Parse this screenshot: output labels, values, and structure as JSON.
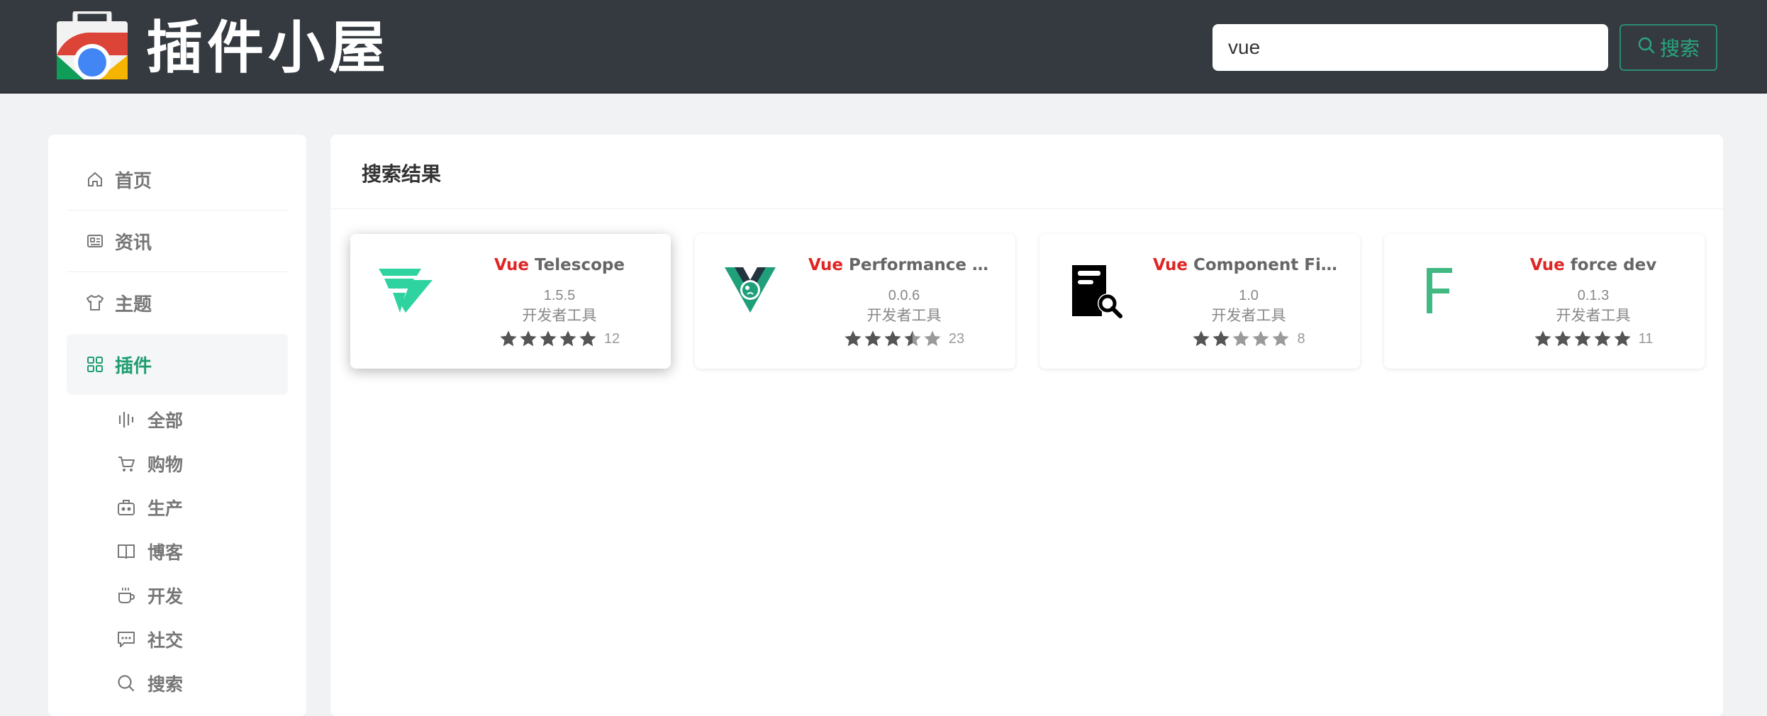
{
  "header": {
    "logo_text": "插件小屋",
    "search_value": "vue",
    "search_button_label": "搜索"
  },
  "sidebar": {
    "items": [
      {
        "label": "首页",
        "icon": "home-icon",
        "active": false
      },
      {
        "label": "资讯",
        "icon": "news-icon",
        "active": false
      },
      {
        "label": "主题",
        "icon": "shirt-icon",
        "active": false
      },
      {
        "label": "插件",
        "icon": "grid-icon",
        "active": true
      }
    ],
    "sub_items": [
      {
        "label": "全部",
        "icon": "bars-icon"
      },
      {
        "label": "购物",
        "icon": "cart-icon"
      },
      {
        "label": "生产",
        "icon": "briefcase-icon"
      },
      {
        "label": "博客",
        "icon": "book-icon"
      },
      {
        "label": "开发",
        "icon": "coffee-icon"
      },
      {
        "label": "社交",
        "icon": "chat-icon"
      },
      {
        "label": "搜索",
        "icon": "search-icon"
      }
    ]
  },
  "main": {
    "title": "搜索结果",
    "results": [
      {
        "keyword": "Vue",
        "name": "Telescope",
        "version": "1.5.5",
        "category": "开发者工具",
        "rating": 5,
        "count": "12",
        "icon": "vue-telescope-logo"
      },
      {
        "keyword": "Vue",
        "name": "Performance Devt...",
        "version": "0.0.6",
        "category": "开发者工具",
        "rating": 3.5,
        "count": "23",
        "icon": "vue-performance-logo"
      },
      {
        "keyword": "Vue",
        "name": "Component Finder",
        "version": "1.0",
        "category": "开发者工具",
        "rating": 2,
        "count": "8",
        "icon": "component-finder-logo"
      },
      {
        "keyword": "Vue",
        "name": "force dev",
        "version": "0.1.3",
        "category": "开发者工具",
        "rating": 5,
        "count": "11",
        "icon": "letter-f-logo"
      }
    ]
  },
  "colors": {
    "header_bg": "#343a40",
    "accent": "#1f9d6f",
    "keyword": "#e02424",
    "star": "#555555"
  }
}
